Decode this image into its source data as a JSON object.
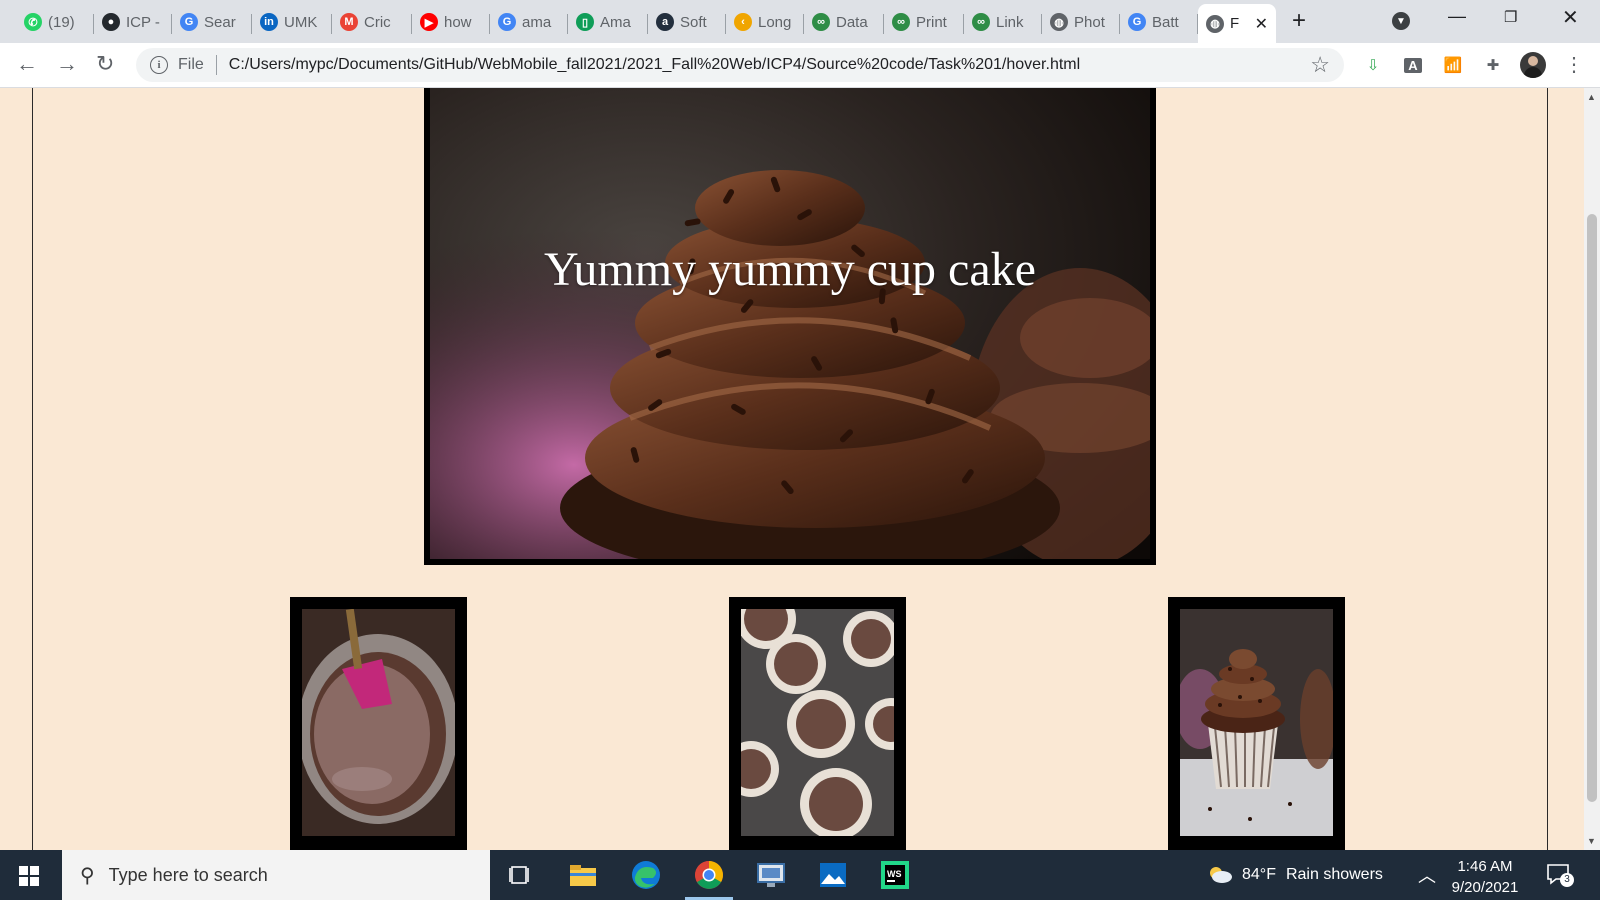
{
  "browser": {
    "tabs": [
      {
        "title": "(19)",
        "favicon": "whatsapp",
        "color": "#25d366",
        "glyph": "✆"
      },
      {
        "title": "ICP -",
        "favicon": "github",
        "color": "#24292e",
        "glyph": "●"
      },
      {
        "title": "Sear",
        "favicon": "google",
        "color": "#4285f4",
        "glyph": "G"
      },
      {
        "title": "UMK",
        "favicon": "linkedin",
        "color": "#0a66c2",
        "glyph": "in"
      },
      {
        "title": "Cric",
        "favicon": "gmail",
        "color": "#ea4335",
        "glyph": "M"
      },
      {
        "title": "how",
        "favicon": "youtube",
        "color": "#ff0000",
        "glyph": "▶"
      },
      {
        "title": "ama",
        "favicon": "google",
        "color": "#4285f4",
        "glyph": "G"
      },
      {
        "title": "Ama",
        "favicon": "sheets",
        "color": "#0f9d58",
        "glyph": "▯"
      },
      {
        "title": "Soft",
        "favicon": "amazon",
        "color": "#232f3e",
        "glyph": "a"
      },
      {
        "title": "Long",
        "favicon": "leetcode",
        "color": "#f0a500",
        "glyph": "‹"
      },
      {
        "title": "Data",
        "favicon": "geeksforgeeks",
        "color": "#2f8d46",
        "glyph": "∞"
      },
      {
        "title": "Print",
        "favicon": "geeksforgeeks",
        "color": "#2f8d46",
        "glyph": "∞"
      },
      {
        "title": "Link",
        "favicon": "geeksforgeeks",
        "color": "#2f8d46",
        "glyph": "∞"
      },
      {
        "title": "Phot",
        "favicon": "globe",
        "color": "#5f6368",
        "glyph": "◍"
      },
      {
        "title": "Batt",
        "favicon": "google",
        "color": "#4285f4",
        "glyph": "G"
      },
      {
        "title": "F",
        "favicon": "globe",
        "color": "#5f6368",
        "glyph": "◍",
        "active": true
      }
    ],
    "address": {
      "scheme_label": "File",
      "url": "C:/Users/mypc/Documents/GitHub/WebMobile_fall2021/2021_Fall%20Web/ICP4/Source%20code/Task%201/hover.html"
    }
  },
  "page": {
    "hero_caption": "Yummy yummy cup cake",
    "background_color": "#fae8d4",
    "thumbnails": [
      {
        "subject": "chocolate batter in bowl with spatula"
      },
      {
        "subject": "cupcake liners with batter in muffin tin"
      },
      {
        "subject": "frosted chocolate cupcake"
      }
    ]
  },
  "taskbar": {
    "search_placeholder": "Type here to search",
    "weather": {
      "temperature": "84°F",
      "condition": "Rain showers"
    },
    "clock": {
      "time": "1:46 AM",
      "date": "9/20/2021"
    },
    "notification_count": "3"
  }
}
